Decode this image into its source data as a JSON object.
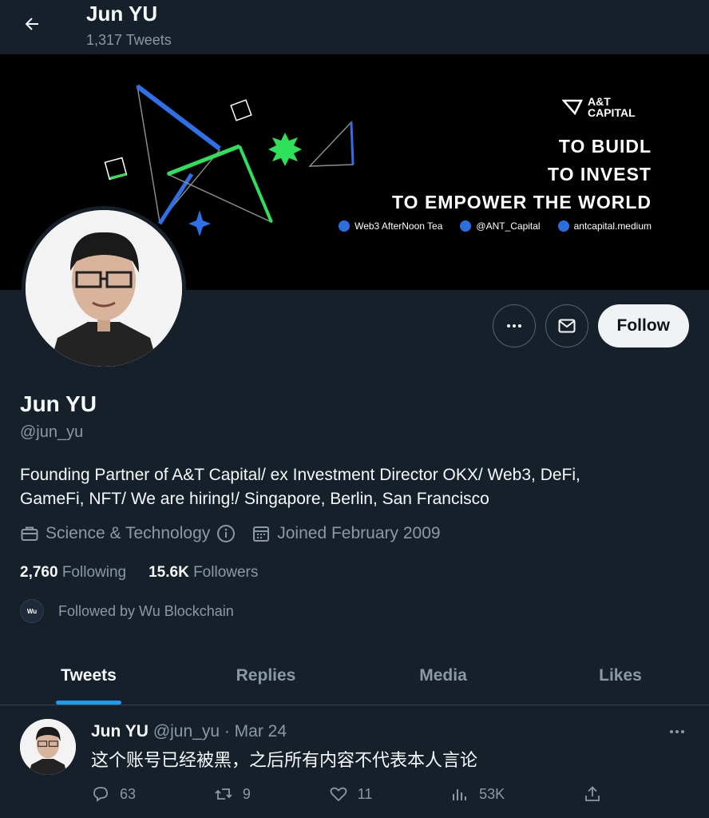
{
  "header": {
    "title": "Jun YU",
    "tweet_count": "1,317 Tweets"
  },
  "banner": {
    "logo_text": "A&T\nCAPITAL",
    "lines": [
      "TO BUIDL",
      "TO INVEST",
      "TO EMPOWER THE WORLD"
    ],
    "links": [
      "Web3 AfterNoon Tea",
      "@ANT_Capital",
      "antcapital.medium"
    ]
  },
  "actions": {
    "follow_label": "Follow"
  },
  "profile": {
    "name": "Jun YU",
    "handle": "@jun_yu",
    "bio_line1": "Founding Partner of A&T Capital/ ex Investment Director OKX/ Web3, DeFi,",
    "bio_line2": "GameFi, NFT/ We are hiring!/ Singapore, Berlin, San Francisco",
    "category": "Science & Technology",
    "joined": "Joined February 2009",
    "following_count": "2,760",
    "following_label": "Following",
    "followers_count": "15.6K",
    "followers_label": "Followers",
    "followed_by": "Followed by Wu Blockchain",
    "followed_by_avatar": "Wu"
  },
  "tabs": [
    "Tweets",
    "Replies",
    "Media",
    "Likes"
  ],
  "tweet": {
    "name": "Jun YU",
    "meta": "@jun_yu · Mar 24",
    "text": "这个账号已经被黑，之后所有内容不代表本人言论",
    "replies": "63",
    "retweets": "9",
    "likes": "11",
    "views": "53K"
  }
}
